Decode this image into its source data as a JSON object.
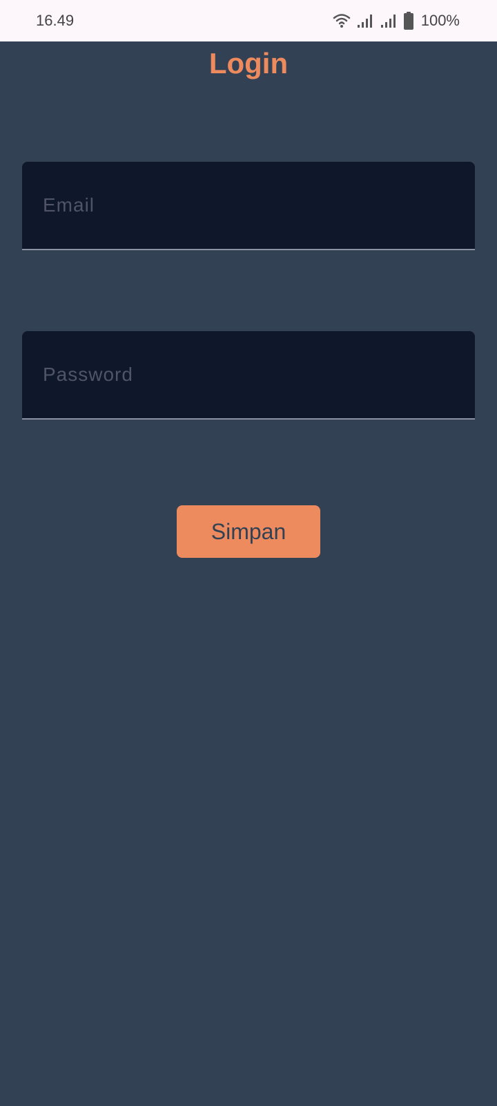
{
  "status_bar": {
    "time": "16.49",
    "battery_percent": "100%",
    "icons": [
      "wifi-icon",
      "signal-icon",
      "signal-icon",
      "battery-icon"
    ]
  },
  "login": {
    "title": "Login",
    "email": {
      "value": "",
      "placeholder": "Email"
    },
    "password": {
      "value": "",
      "placeholder": "Password"
    },
    "save_label": "Simpan"
  },
  "colors": {
    "background": "#334155",
    "field_background": "#0f172a",
    "accent": "#ee8b5e",
    "status_bar": "#fdf7fc"
  }
}
